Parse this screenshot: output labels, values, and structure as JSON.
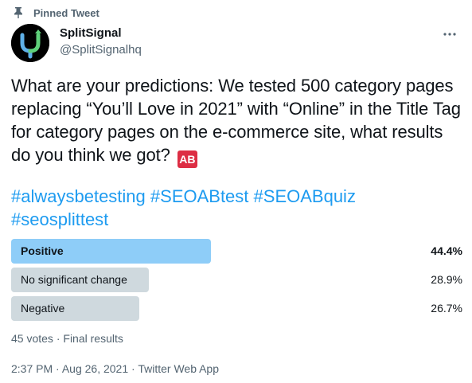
{
  "pinned_label": "Pinned Tweet",
  "author": {
    "name": "SplitSignal",
    "handle": "@SplitSignalhq"
  },
  "tweet_text": "What are your predictions: We tested 500 category pages replacing “You’ll Love in 2021” with “Online” in the Title Tag for category pages on the e-commerce site, what results do you think we got?",
  "emoji": "AB",
  "hashtags": [
    "#alwaysbetesting",
    "#SEOABtest",
    "#SEOABquiz",
    "#seosplittest"
  ],
  "poll": {
    "options": [
      {
        "label": "Positive",
        "percent": "44.4%",
        "value": 44.4,
        "winner": true
      },
      {
        "label": "No significant change",
        "percent": "28.9%",
        "value": 28.9,
        "winner": false
      },
      {
        "label": "Negative",
        "percent": "26.7%",
        "value": 26.7,
        "winner": false
      }
    ],
    "votes": "45 votes",
    "separator": "·",
    "status": "Final results"
  },
  "timestamp": {
    "time": "2:37 PM",
    "date": "Aug 26, 2021",
    "source": "Twitter Web App",
    "separator": "·"
  },
  "colors": {
    "link": "#1d9bf0",
    "secondary_text": "#536471",
    "winner_bar": "#8ecdf8",
    "bar": "#cfd9de"
  },
  "icons": {
    "pinned": "pin-icon",
    "more": "more-dots-icon"
  }
}
